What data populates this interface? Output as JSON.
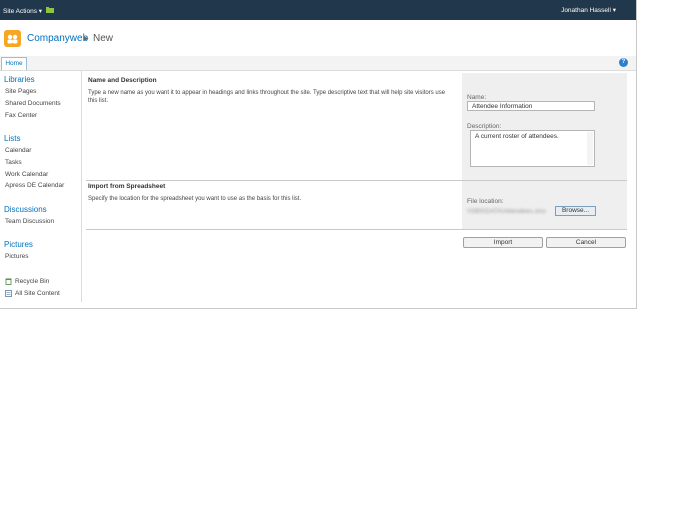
{
  "topbar": {
    "site_actions": "Site Actions ▾",
    "user": "Jonathan Hassell ▾"
  },
  "title": {
    "site": "Companyweb",
    "separator": "▸",
    "page": "New"
  },
  "nav": {
    "home_tab": "Home",
    "help": "?"
  },
  "quicklaunch": {
    "libraries": {
      "heading": "Libraries",
      "items": [
        "Site Pages",
        "Shared Documents",
        "Fax Center"
      ]
    },
    "lists": {
      "heading": "Lists",
      "items": [
        "Calendar",
        "Tasks",
        "Work Calendar",
        "Apress DE Calendar"
      ]
    },
    "discussions": {
      "heading": "Discussions",
      "items": [
        "Team Discussion"
      ]
    },
    "pictures": {
      "heading": "Pictures",
      "items": [
        "Pictures"
      ]
    },
    "recycle_bin": "Recycle Bin",
    "all_site_content": "All Site Content"
  },
  "form": {
    "name_section": {
      "title": "Name and Description",
      "description": "Type a new name as you want it to appear in headings and links throughout the site. Type descriptive text that will help site visitors use this list.",
      "name_label": "Name:",
      "name_value": "Attendee Information",
      "desc_label": "Description:",
      "desc_value": "A current roster of attendees."
    },
    "import_section": {
      "title": "Import from Spreadsheet",
      "description": "Specify the location for the spreadsheet you want to use as the basis for this list.",
      "file_label": "File location:",
      "file_value": "\\\\SBS\\DATA\\Attendees.xlsx",
      "browse_label": "Browse..."
    },
    "import_button": "Import",
    "cancel_button": "Cancel"
  },
  "colors": {
    "topbar": "#21374c",
    "link": "#0072bc",
    "logo": "#f5a623"
  }
}
